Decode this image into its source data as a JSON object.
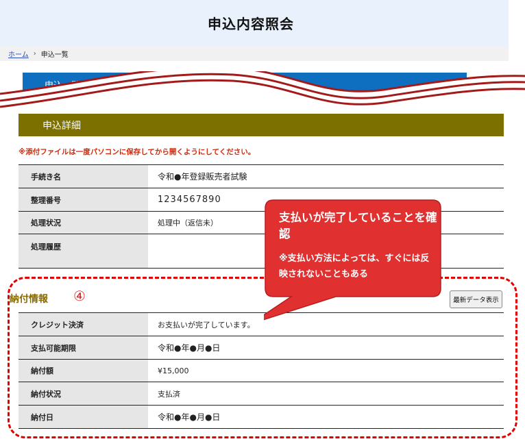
{
  "header": {
    "title": "申込内容照会"
  },
  "breadcrumb": {
    "home": "ホーム",
    "separator": "›",
    "current": "申込一覧"
  },
  "section_bar": {
    "label": "申込一覧"
  },
  "detail": {
    "title": "申込詳細",
    "warning": "※添付ファイルは一度パソコンに保存してから開くようにしてください。",
    "rows": [
      {
        "label": "手続き名",
        "value": "令和●年登録販売者試験"
      },
      {
        "label": "整理番号",
        "value": "1234567890"
      },
      {
        "label": "処理状況",
        "value": "処理中（返信未）"
      },
      {
        "label": "処理履歴",
        "value": ""
      }
    ]
  },
  "payment": {
    "title": "納付情報",
    "step_marker": "④",
    "refresh_button": "最新データ表示",
    "rows": [
      {
        "label": "クレジット決済",
        "value": "お支払いが完了しています。"
      },
      {
        "label": "支払可能期限",
        "value": "令和●年●月●日"
      },
      {
        "label": "納付額",
        "value": "¥15,000"
      },
      {
        "label": "納付状況",
        "value": "支払済"
      },
      {
        "label": "納付日",
        "value": "令和●年●月●日"
      }
    ]
  },
  "callout": {
    "title": "支払いが完了していることを確認",
    "note": "※支払い方法によっては、すぐには反映されないこともある"
  },
  "colors": {
    "header_bg": "#e8f1fc",
    "blue_bar": "#0e6fc1",
    "olive_bar": "#7c7000",
    "warning": "#d12a0a",
    "callout": "#e03030",
    "dashed_border": "#e00000"
  }
}
